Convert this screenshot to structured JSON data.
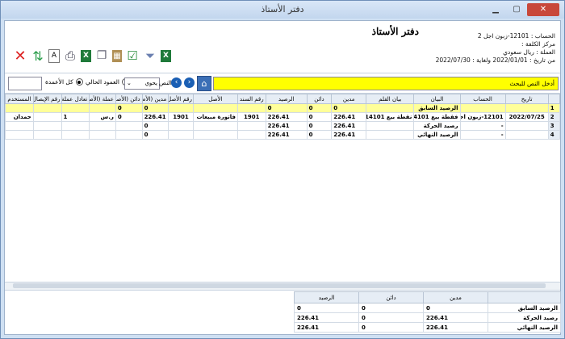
{
  "window": {
    "title": "دفتر الأستاذ"
  },
  "report": {
    "title": "دفتر الأستاذ",
    "account_line": "الحساب : 12101-زبون اجل 2",
    "cost_center_line": "مركز الكلفة :",
    "currency_line": "العملة : ريال سعودي",
    "date_line": "من تاريخ : 2022/01/01 ولغاية : 2022/07/30"
  },
  "toolbar": {
    "icons": [
      "excel-icon",
      "filter-icon",
      "calculator-icon",
      "check-icon",
      "copy-icon",
      "excel-icon",
      "print-icon",
      "document-icon",
      "refresh-icon",
      "close-icon"
    ]
  },
  "search": {
    "placeholder": "أدخل النص للبحث",
    "all_columns_label": "كل الأعمدة",
    "current_column_label": "العمود الحالي",
    "text_label": "النص",
    "contains_value": "يحوي",
    "all_columns_selected": true
  },
  "grid": {
    "columns": [
      "تاريخ",
      "الحساب",
      "البيان",
      "بيان القلم",
      "مدين",
      "دائن",
      "الرصيد",
      "رقم السند",
      "الأصل",
      "رقم الأصل",
      "مدين (الأصل)",
      "دائن (الأصل)",
      "عملة (الأصل)",
      "تعادل عملة الأصل",
      "رقم الإيصال",
      "المستخدم"
    ],
    "rows": [
      {
        "n": "1",
        "date": "",
        "account": "",
        "desc": "الرصيد السابق",
        "line": "",
        "debit": "0",
        "credit": "0",
        "balance": "0",
        "voucher": "",
        "origin": "",
        "origin_no": "",
        "o_debit": "0",
        "o_credit": "0",
        "o_cur": "",
        "o_rate": "",
        "receipt": "",
        "user": ""
      },
      {
        "n": "2",
        "date": "2022/07/25",
        "account": "12101-زبون اجل 2",
        "desc": "فقطة بيع 14101",
        "line": "نقطة بيع 14101",
        "debit": "226.41",
        "credit": "0",
        "balance": "226.41",
        "voucher": "1901",
        "origin": "فاتورة مبيعات",
        "origin_no": "1901",
        "o_debit": "226.41",
        "o_credit": "0",
        "o_cur": "ر.س",
        "o_rate": "1",
        "receipt": "",
        "user": "حمدان"
      },
      {
        "n": "3",
        "date": "",
        "account": "-",
        "desc": "رصيد الحركة",
        "line": "",
        "debit": "226.41",
        "credit": "0",
        "balance": "226.41",
        "voucher": "",
        "origin": "",
        "origin_no": "",
        "o_debit": "0",
        "o_credit": "",
        "o_cur": "",
        "o_rate": "",
        "receipt": "",
        "user": ""
      },
      {
        "n": "4",
        "date": "",
        "account": "-",
        "desc": "الرصيد النهائي",
        "line": "",
        "debit": "226.41",
        "credit": "0",
        "balance": "226.41",
        "voucher": "",
        "origin": "",
        "origin_no": "",
        "o_debit": "0",
        "o_credit": "",
        "o_cur": "",
        "o_rate": "",
        "receipt": "",
        "user": ""
      }
    ]
  },
  "summary": {
    "headers": [
      "مدين",
      "دائن",
      "الرصيد"
    ],
    "rows": [
      {
        "label": "الرصيد السابق",
        "debit": "0",
        "credit": "0",
        "balance": "0"
      },
      {
        "label": "رصيد الحركة",
        "debit": "226.41",
        "credit": "0",
        "balance": "226.41"
      },
      {
        "label": "الرصيد النهائي",
        "debit": "226.41",
        "credit": "0",
        "balance": "226.41"
      }
    ]
  },
  "colors": {
    "highlight": "#ffff00",
    "row_yellow": "#ffff99",
    "selection": "#a6c8e8",
    "title_bar": "#c2d6ee"
  }
}
